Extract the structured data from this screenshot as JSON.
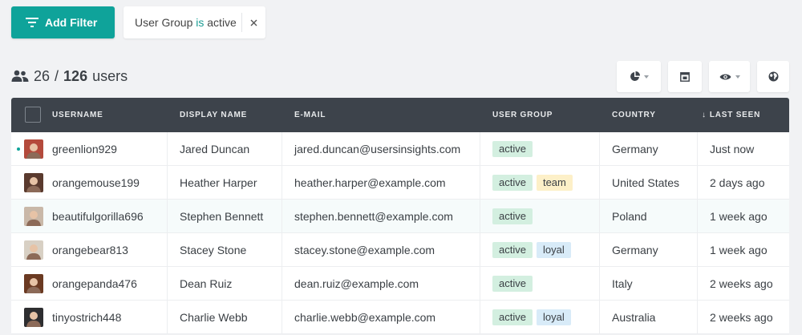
{
  "toolbar": {
    "add_filter_label": "Add Filter",
    "filter": {
      "field": "User Group",
      "operator": "is",
      "value": "active"
    }
  },
  "count": {
    "shown": "26",
    "separator": "/",
    "total": "126",
    "unit": "users"
  },
  "colors": {
    "accent": "#0fa39a",
    "header_bg": "#3d434b",
    "tag_active": "#d3efe0",
    "tag_team": "#fdf0c8",
    "tag_loyal": "#d8ebf8"
  },
  "icons": {
    "add_filter": "filter-lines-icon",
    "count": "users-icon",
    "segments": "pie-chart-icon",
    "layout": "window-icon",
    "columns": "eye-icon",
    "map": "globe-icon"
  },
  "table": {
    "columns": [
      "USERNAME",
      "DISPLAY NAME",
      "E-MAIL",
      "USER GROUP",
      "COUNTRY",
      "LAST SEEN"
    ],
    "sort_indicator": "↓",
    "rows": [
      {
        "username": "greenlion929",
        "display_name": "Jared Duncan",
        "email": "jared.duncan@usersinsights.com",
        "groups": [
          "active"
        ],
        "country": "Germany",
        "last_seen": "Just now",
        "online": true,
        "avatar_color": "#b44a3c"
      },
      {
        "username": "orangemouse199",
        "display_name": "Heather Harper",
        "email": "heather.harper@example.com",
        "groups": [
          "active",
          "team"
        ],
        "country": "United States",
        "last_seen": "2 days ago",
        "online": false,
        "avatar_color": "#5a3a2e"
      },
      {
        "username": "beautifulgorilla696",
        "display_name": "Stephen Bennett",
        "email": "stephen.bennett@example.com",
        "groups": [
          "active"
        ],
        "country": "Poland",
        "last_seen": "1 week ago",
        "online": false,
        "avatar_color": "#c9b8a8"
      },
      {
        "username": "orangebear813",
        "display_name": "Stacey Stone",
        "email": "stacey.stone@example.com",
        "groups": [
          "active",
          "loyal"
        ],
        "country": "Germany",
        "last_seen": "1 week ago",
        "online": false,
        "avatar_color": "#d8d0c4"
      },
      {
        "username": "orangepanda476",
        "display_name": "Dean Ruiz",
        "email": "dean.ruiz@example.com",
        "groups": [
          "active"
        ],
        "country": "Italy",
        "last_seen": "2 weeks ago",
        "online": false,
        "avatar_color": "#6b3a22"
      },
      {
        "username": "tinyostrich448",
        "display_name": "Charlie Webb",
        "email": "charlie.webb@example.com",
        "groups": [
          "active",
          "loyal"
        ],
        "country": "Australia",
        "last_seen": "2 weeks ago",
        "online": false,
        "avatar_color": "#2e2e30"
      }
    ]
  }
}
